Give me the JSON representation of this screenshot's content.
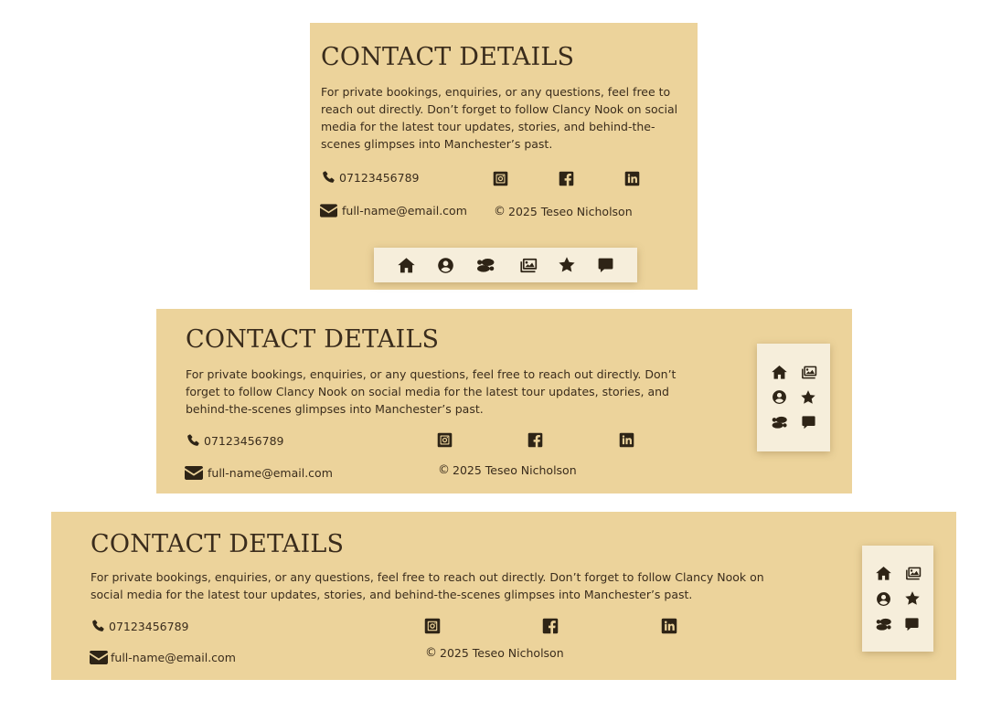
{
  "contact": {
    "title": "CONTACT DETAILS",
    "description": "For private bookings, enquiries, or any questions, feel free to reach out directly. Don’t forget to follow Clancy Nook on social media for the latest tour updates, stories, and behind-the-scenes glimpses into Manchester’s past.",
    "phone": "07123456789",
    "email": "full-name@email.com",
    "copyright": "2025 Teseo Nicholson",
    "copyright_symbol": "©"
  },
  "social": [
    "instagram-icon",
    "facebook-icon",
    "linkedin-icon"
  ],
  "nav": [
    "home-icon",
    "profile-icon",
    "footsteps-icon",
    "gallery-icon",
    "star-icon",
    "chat-icon"
  ],
  "colors": {
    "panel": "#ecd39b",
    "nav_bg": "#f6eedb",
    "text": "#3a2c1c"
  }
}
